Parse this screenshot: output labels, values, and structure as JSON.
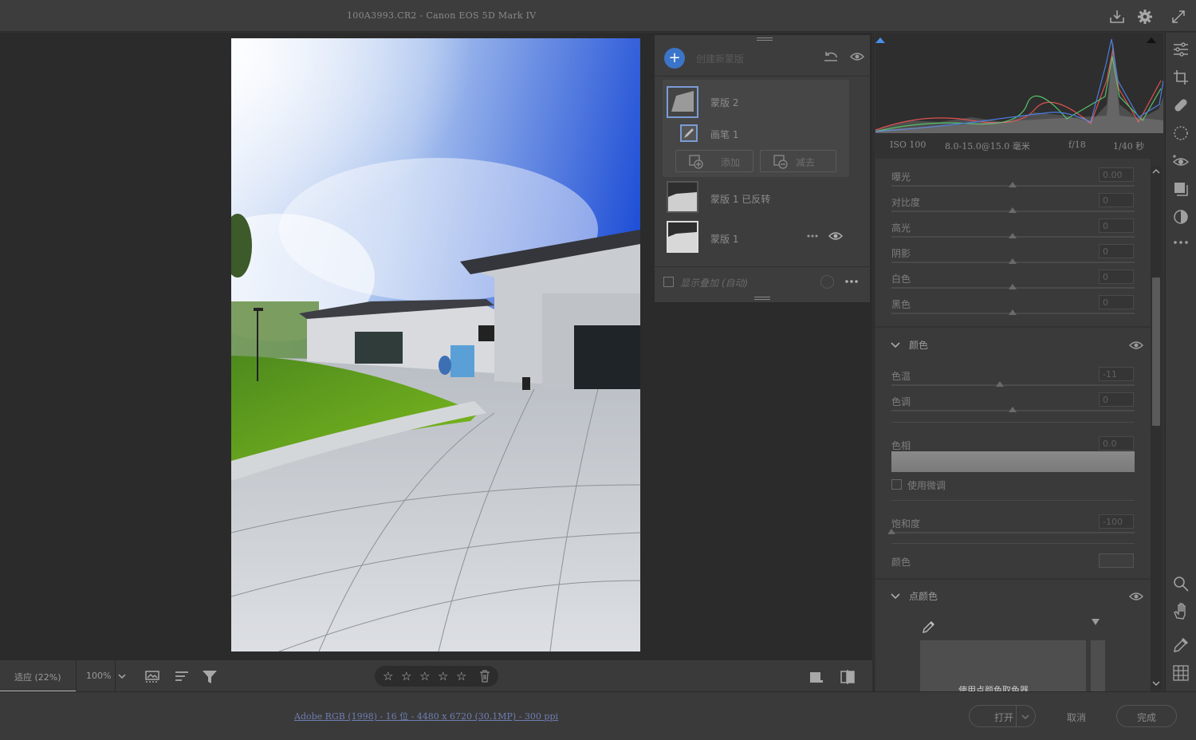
{
  "window": {
    "title": "100A3993.CR2 -  Canon EOS 5D Mark IV"
  },
  "toolbar_icons": [
    "save-icon",
    "gear-icon",
    "fullscreen-icon"
  ],
  "bottom_bar": {
    "zoom_fit": "适应 (22%)",
    "zoom_100": "100%",
    "stars": [
      "☆",
      "☆",
      "☆",
      "☆",
      "☆"
    ]
  },
  "status_bar": {
    "file_info": "Adobe RGB (1998) - 16 位 - 4480 x 6720 (30.1MP) - 300 ppi",
    "open_label": "打开",
    "cancel_label": "取消",
    "done_label": "完成"
  },
  "mask_panel": {
    "create_new": "创建新蒙版",
    "mask2": "蒙版 2",
    "brush1": "画笔 1",
    "add_label": "添加",
    "subtract_label": "减去",
    "mask1_inverted": "蒙版 1 已反转",
    "mask1": "蒙版 1",
    "show_overlay": "显示叠加 (自动)"
  },
  "exif": {
    "iso": "ISO 100",
    "focal": "8.0-15.0@15.0 毫米",
    "aperture": "f/18",
    "shutter": "1/40 秒"
  },
  "light": {
    "sliders": [
      {
        "label": "曝光",
        "value": "0.00",
        "pos": 0.5
      },
      {
        "label": "对比度",
        "value": "0",
        "pos": 0.5
      },
      {
        "label": "高光",
        "value": "0",
        "pos": 0.5
      },
      {
        "label": "阴影",
        "value": "0",
        "pos": 0.5
      },
      {
        "label": "白色",
        "value": "0",
        "pos": 0.5
      },
      {
        "label": "黑色",
        "value": "0",
        "pos": 0.5
      }
    ]
  },
  "color": {
    "title": "颜色",
    "temp": {
      "label": "色温",
      "value": "-11",
      "pos": 0.445
    },
    "tint": {
      "label": "色调",
      "value": "0",
      "pos": 0.5
    },
    "hue": {
      "label": "色相",
      "value": "0.0"
    },
    "fine_adjust": "使用微调",
    "saturation": {
      "label": "饱和度",
      "value": "-100",
      "pos": 0.0
    },
    "color_label": "颜色"
  },
  "point_color": {
    "title": "点颜色",
    "hint": "使用点颜色取色器"
  }
}
